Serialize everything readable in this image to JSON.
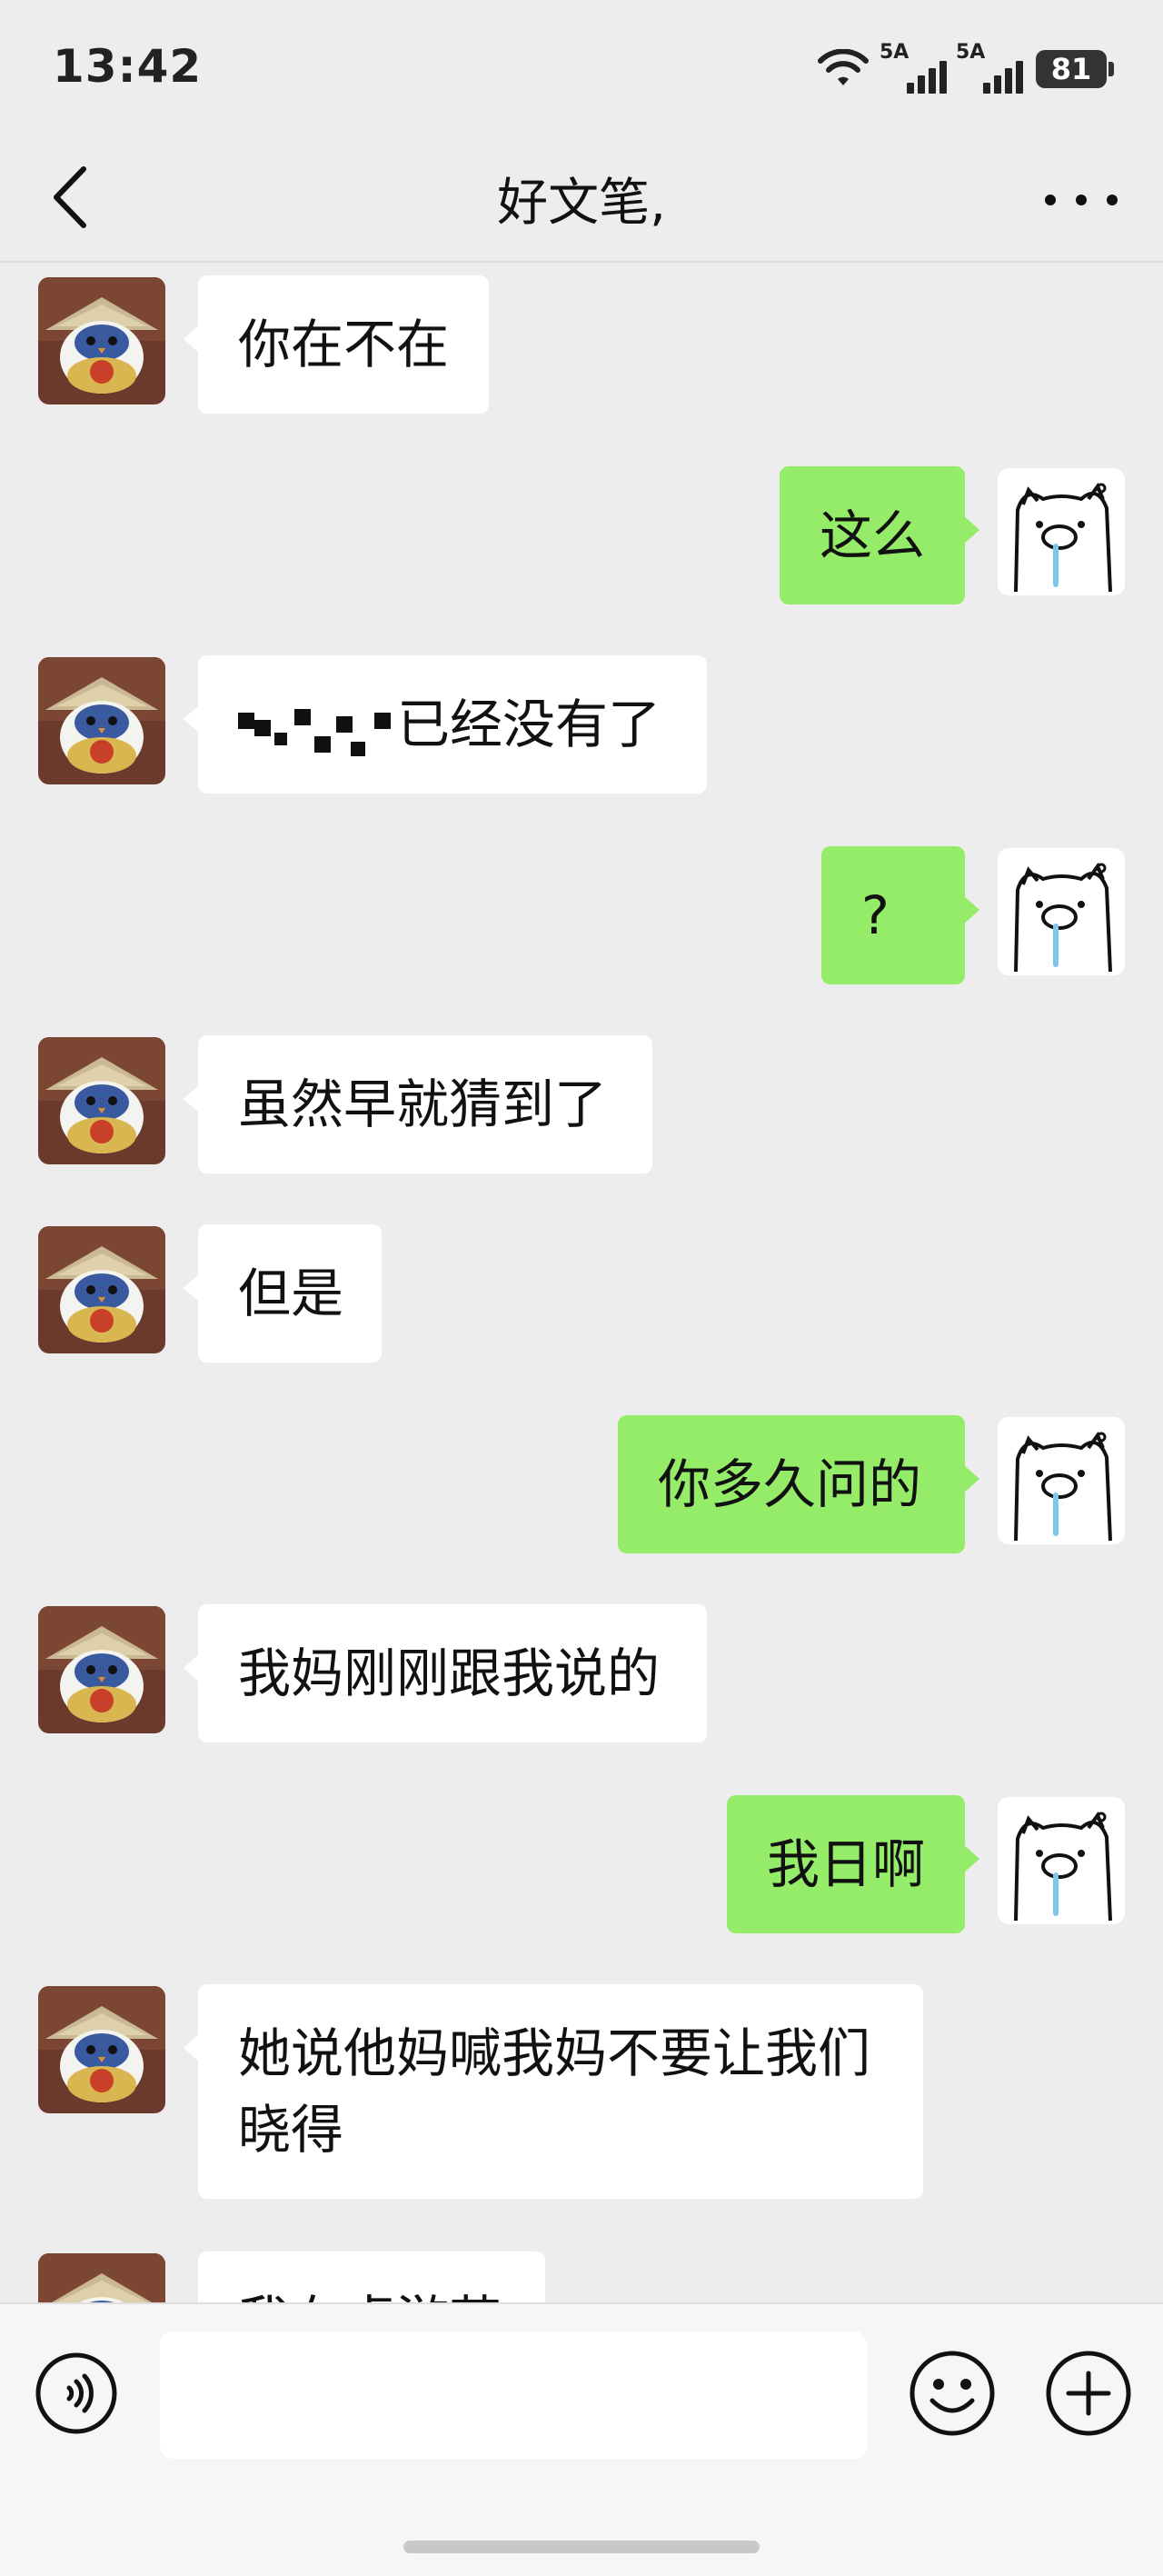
{
  "status_bar": {
    "time": "13:42",
    "network_1": "5A",
    "network_2": "5A",
    "battery": "81",
    "icons": [
      "wifi-icon",
      "signal-icon",
      "signal-icon",
      "battery-icon"
    ]
  },
  "header": {
    "title": "好文笔,",
    "back_icon": "chevron-left-icon",
    "more_icon": "more-dots-icon"
  },
  "messages": [
    {
      "side": "in",
      "text": "你在不在"
    },
    {
      "side": "out",
      "text": "这么"
    },
    {
      "side": "in",
      "text": "已经没有了",
      "redacted_prefix": true
    },
    {
      "side": "out",
      "text": "?"
    },
    {
      "side": "in",
      "text": "虽然早就猜到了"
    },
    {
      "side": "in",
      "text": "但是"
    },
    {
      "side": "out",
      "text": "你多久问的"
    },
    {
      "side": "in",
      "text": "我妈刚刚跟我说的"
    },
    {
      "side": "out",
      "text": "我日啊"
    },
    {
      "side": "in",
      "text": "她说他妈喊我妈不要让我们晓得"
    },
    {
      "side": "in",
      "text": "我在桌游若"
    }
  ],
  "input_bar": {
    "voice_icon": "voice-icon",
    "emoji_icon": "emoji-icon",
    "plus_icon": "plus-icon",
    "input_value": ""
  },
  "colors": {
    "background": "#ededed",
    "bubble_out": "#95ec69",
    "bubble_in": "#ffffff"
  }
}
